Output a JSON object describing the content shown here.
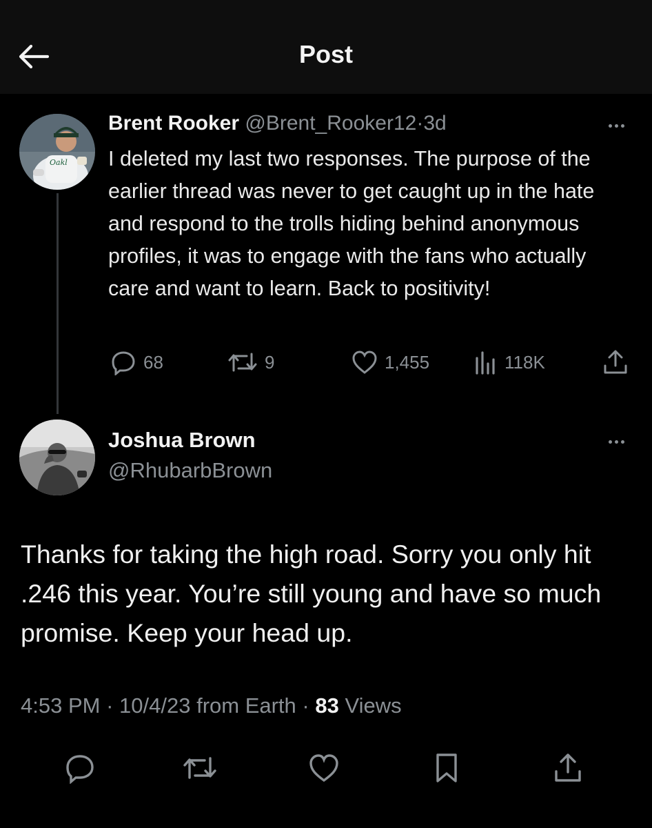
{
  "header": {
    "title": "Post",
    "back_icon": "arrow-left-icon"
  },
  "parent_post": {
    "display_name": "Brent Rooker",
    "handle": "@Brent_Rooker12",
    "separator": "·",
    "time": "3d",
    "text": "I deleted my last two responses. The purpose of the earlier thread was never to get caught up in the hate and respond to the trolls hiding behind anonymous profiles, it was to engage with the fans who actually care and want to learn. Back to positivity!",
    "stats": {
      "replies": "68",
      "reposts": "9",
      "likes": "1,455",
      "views": "118K"
    }
  },
  "reply_post": {
    "display_name": "Joshua Brown",
    "handle": "@RhubarbBrown",
    "text": "Thanks for taking the high road. Sorry you only hit .246 this year. You’re still young and have so much promise. Keep your head up.",
    "time": "4:53 PM",
    "date": "10/4/23",
    "source": "from Earth",
    "views_count": "83",
    "views_label": "Views"
  },
  "colors": {
    "background": "#000000",
    "header": "#0e0e0e",
    "text": "#e7e9ea",
    "muted": "#8b9095"
  }
}
